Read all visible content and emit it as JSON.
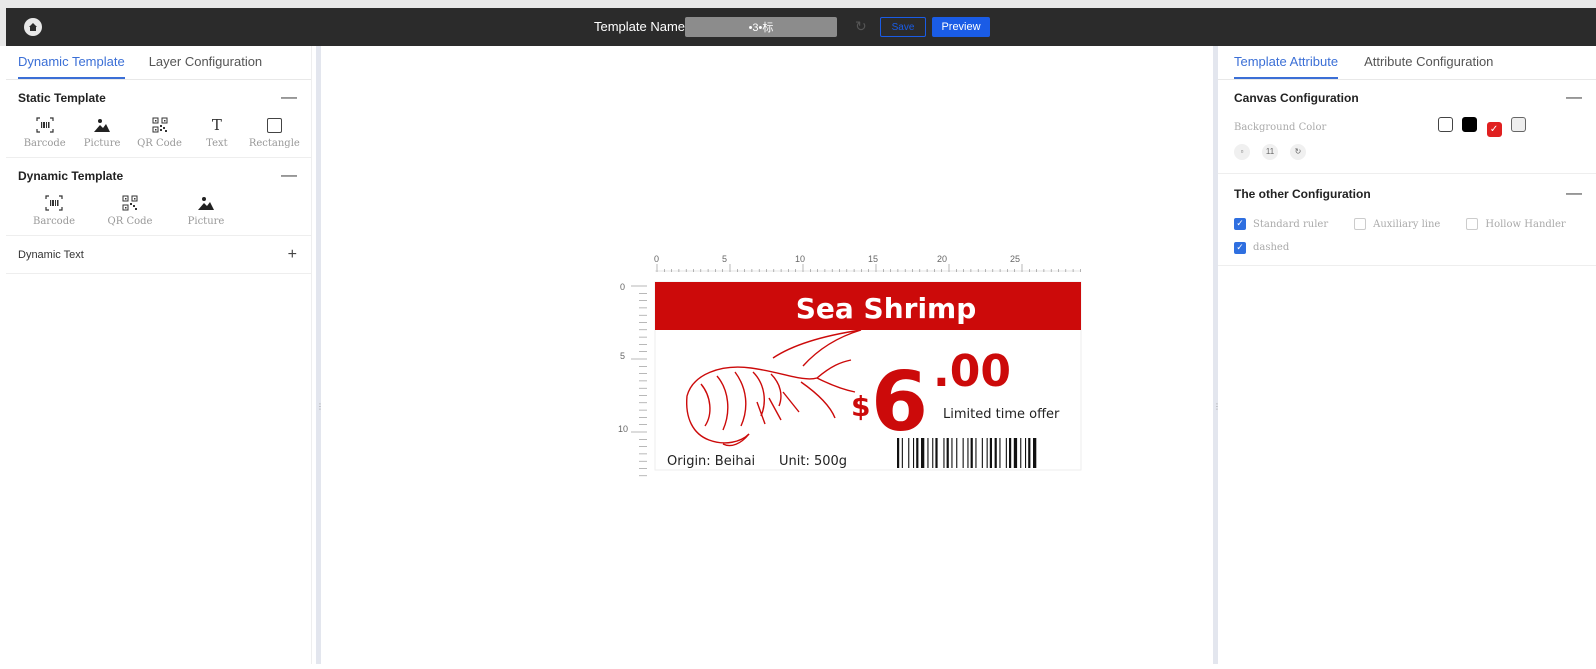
{
  "header": {
    "template_name_label": "Template Name",
    "template_name_value": "•3•标",
    "save_label": "Save",
    "preview_label": "Preview"
  },
  "left_panel": {
    "tabs": [
      {
        "label": "Dynamic Template",
        "active": true
      },
      {
        "label": "Layer Configuration",
        "active": false
      }
    ],
    "static_template": {
      "title": "Static Template",
      "toggle": "—",
      "tools": [
        {
          "label": "Barcode",
          "icon": "barcode-icon"
        },
        {
          "label": "Picture",
          "icon": "picture-icon"
        },
        {
          "label": "QR Code",
          "icon": "qr-code-icon"
        },
        {
          "label": "Text",
          "icon": "text-icon"
        },
        {
          "label": "Rectangle",
          "icon": "rectangle-icon"
        }
      ]
    },
    "dynamic_template": {
      "title": "Dynamic Template",
      "toggle": "—",
      "tools": [
        {
          "label": "Barcode",
          "icon": "barcode-icon"
        },
        {
          "label": "QR Code",
          "icon": "qr-code-icon"
        },
        {
          "label": "Picture",
          "icon": "picture-icon"
        }
      ]
    },
    "dynamic_text": {
      "title": "Dynamic Text",
      "toggle": "+"
    }
  },
  "canvas": {
    "ruler_top_labels": [
      "0",
      "5",
      "10",
      "15",
      "20",
      "25"
    ],
    "ruler_left_labels": [
      "0",
      "5",
      "10"
    ],
    "label": {
      "title": "Sea Shrimp",
      "currency": "$",
      "price_int": "6",
      "price_dec": ".00",
      "offer": "Limited time offer",
      "origin": "Origin: Beihai",
      "unit": "Unit: 500g",
      "accent_color": "#cc0a0a"
    }
  },
  "right_panel": {
    "tabs": [
      {
        "label": "Template Attribute",
        "active": true
      },
      {
        "label": "Attribute Configuration",
        "active": false
      }
    ],
    "canvas_config": {
      "title": "Canvas Configuration",
      "toggle": "—",
      "bg_color_label": "Background Color",
      "colors": [
        "#ffffff",
        "#000000",
        "#e02020",
        "#eeeeee"
      ],
      "selected_color": "#e02020",
      "mini_value": "11"
    },
    "other_config": {
      "title": "The other Configuration",
      "toggle": "—",
      "options": [
        {
          "label": "Standard ruler",
          "checked": true
        },
        {
          "label": "Auxiliary line",
          "checked": false
        },
        {
          "label": "Hollow Handler",
          "checked": false
        },
        {
          "label": "dashed",
          "checked": true
        }
      ]
    }
  }
}
